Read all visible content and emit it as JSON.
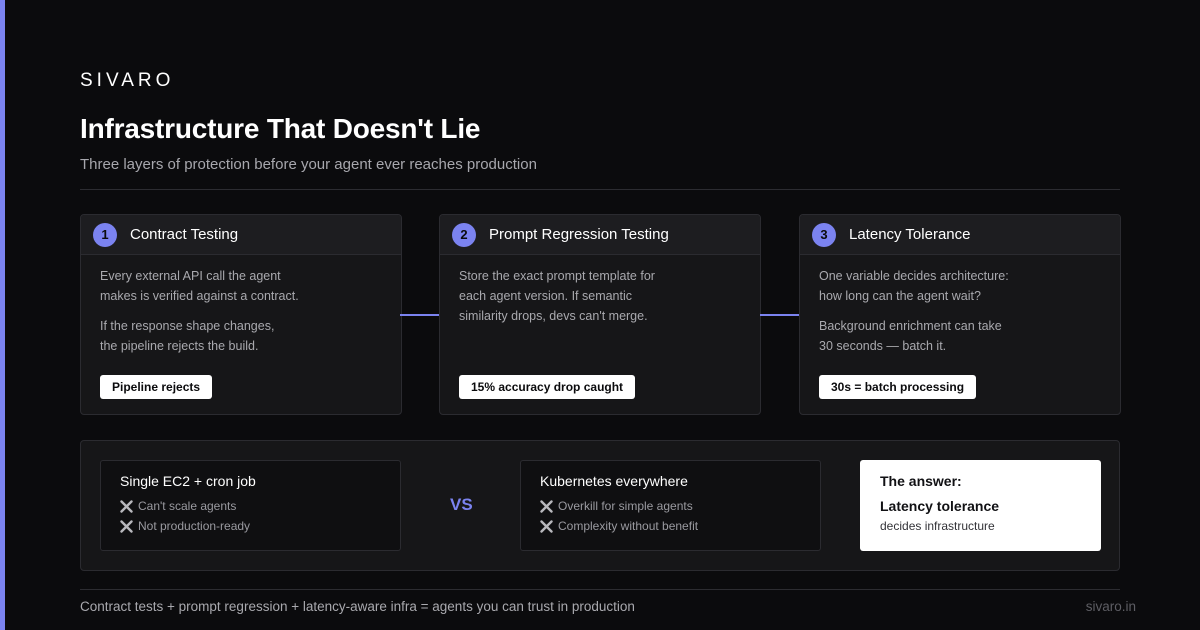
{
  "brand": "SIVARO",
  "title": "Infrastructure That Doesn't Lie",
  "subtitle": "Three layers of protection before your agent ever reaches production",
  "accent_color": "#7b83f0",
  "cards": [
    {
      "number": "1",
      "title": "Contract Testing",
      "paragraphs": [
        [
          "Every external API call the agent",
          "makes is verified against a contract."
        ],
        [
          "If the response shape changes,",
          "the pipeline rejects the build."
        ]
      ],
      "tag": "Pipeline rejects"
    },
    {
      "number": "2",
      "title": "Prompt Regression Testing",
      "paragraphs": [
        [
          "Store the exact prompt template for",
          "each agent version. If semantic",
          "similarity drops, devs can't merge."
        ]
      ],
      "tag": "15% accuracy drop caught"
    },
    {
      "number": "3",
      "title": "Latency Tolerance",
      "paragraphs": [
        [
          "One variable decides architecture:",
          "how long can the agent wait?"
        ],
        [
          "Background enrichment can take",
          "30 seconds — batch it."
        ]
      ],
      "tag": "30s = batch processing"
    }
  ],
  "comparison": {
    "left": {
      "title": "Single EC2 + cron job",
      "cons": [
        "Can't scale agents",
        "Not production-ready"
      ],
      "con_icon": "x-icon"
    },
    "vs_label": "VS",
    "right": {
      "title": "Kubernetes everywhere",
      "cons": [
        "Overkill for simple agents",
        "Complexity without benefit"
      ],
      "con_icon": "x-icon"
    },
    "answer": {
      "label": "The answer:",
      "title": "Latency tolerance",
      "subtitle": "decides infrastructure"
    }
  },
  "footer": {
    "text": "Contract tests + prompt regression + latency-aware infra = agents you can trust in production",
    "domain": "sivaro.in"
  }
}
